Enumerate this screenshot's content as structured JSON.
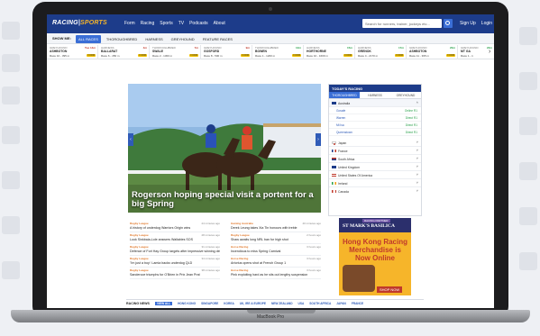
{
  "device": {
    "label": "MacBook Pro"
  },
  "site": {
    "logo_part1": "RACING",
    "logo_part2": "SPORTS",
    "menu": [
      "Form",
      "Racing",
      "Sports",
      "TV",
      "Podcasts",
      "About"
    ],
    "search_placeholder": "Search for runners, trainer, jockeys etc...",
    "signup": "Sign Up",
    "login": "Login"
  },
  "filters": {
    "label": "SHOW ME:",
    "items": [
      "ALL RACES",
      "THOROUGHBRED",
      "HARNESS",
      "GREYHOUND",
      "FEATURE RACES"
    ]
  },
  "races": [
    {
      "type": "GREYHOUND",
      "time": "Tue 14m",
      "venue": "ASHBOTON",
      "detail": "Race 10 - 395 m",
      "badge": "FORM"
    },
    {
      "type": "HARNESS",
      "time": "4m",
      "venue": "BALLARAT",
      "detail": "Race 6 - 450 m",
      "badge": "FORM"
    },
    {
      "type": "THOROUGHBRED",
      "time": "7m",
      "venue": "SWALE",
      "detail": "Race 2 - 1300 m",
      "badge": "FORM"
    },
    {
      "type": "GREYHOUND",
      "time": "9m",
      "venue": "GOSFORD",
      "detail": "Race 8 - 500 m",
      "badge": "FORM"
    },
    {
      "type": "THOROUGHBRED",
      "time": "12m",
      "venue": "BOWEN",
      "detail": "Race 1 - 1200 m",
      "badge": "FORM"
    },
    {
      "type": "HARNESS",
      "time": "15m",
      "venue": "HORTHORNE",
      "detail": "Race 10 - 1609 m",
      "badge": "FORM"
    },
    {
      "type": "HARNESS",
      "time": "17m",
      "venue": "GRENOK",
      "detail": "Race 4 - 2170 m",
      "badge": "FORM"
    },
    {
      "type": "GREYHOUND",
      "time": "20m",
      "venue": "ASHBOTON",
      "detail": "Race 11 - 395 m",
      "badge": "FORM"
    },
    {
      "type": "GREYHOUND",
      "time": "22m",
      "venue": "MT GA",
      "detail": "Race 1 - 1",
      "badge": ""
    }
  ],
  "hero": {
    "title": "Rogerson hoping special visit a portent for a big Spring"
  },
  "todays_racing": {
    "header": "TODAY'S RACING",
    "tabs": [
      "THOROUGHBRED",
      "HARNESS",
      "GREYHOUND"
    ],
    "australia": "Australia",
    "states": [
      {
        "name": "Gosafe",
        "value": "Online R1"
      },
      {
        "name": "Warren",
        "value": "Direct R1"
      },
      {
        "name": "Mt Isa",
        "value": "Direct R1"
      },
      {
        "name": "Queenstown",
        "value": "Direct R1"
      }
    ],
    "countries": [
      "Japan",
      "France",
      "South Africa",
      "United Kingdom",
      "United States Of America",
      "Ireland",
      "Canada"
    ]
  },
  "ad": {
    "tag": "RACING PARTNER",
    "brand": "ST MARK'S BASILICA",
    "text": "Hong Kong Racing Merchandise is Now Online",
    "cta": "SHOP NOW"
  },
  "news_left": [
    {
      "cat": "Rugby League",
      "time": "24 minutes ago",
      "head": "A history of underdog Warriors Origin wins"
    },
    {
      "cat": "Rugby League",
      "time": "28 minutes ago",
      "head": "Look Sinkbaia-Lole answers Wallabies SOS"
    },
    {
      "cat": "Rugby League",
      "time": "31 minutes ago",
      "head": "Defence of Fort Hay Group targets after impressive winning debut"
    },
    {
      "cat": "Rugby League",
      "time": "34 minutes ago",
      "head": "'I'm just a boy': Lamia backs underdog QLD"
    },
    {
      "cat": "Rugby League",
      "time": "38 minutes ago",
      "head": "Sandercoe triumphs for O'Brien in Prix Jean Prat"
    }
  ],
  "news_right": [
    {
      "cat": "Gaming Australia",
      "time": "40 minutes ago",
      "head": "Derek Leung takes Xia Tin honours with treble"
    },
    {
      "cat": "Rugby League",
      "time": "2 hours ago",
      "head": "Shaw awaits long NRL ban for high shot"
    },
    {
      "cat": "Horse Racing",
      "time": "3 hours ago",
      "head": "Incendious to miss Spring Carnival"
    },
    {
      "cat": "Horse Racing",
      "time": "3 hours ago",
      "head": "Artorius opens shot at French Group 1"
    },
    {
      "cat": "Horse Racing",
      "time": "3 hours ago",
      "head": "Pink exploiting hard as he sits out lengthy suspension"
    }
  ],
  "footer_strip": {
    "label": "RACING NEWS",
    "items": [
      "VIEW ALL",
      "HONG KONG",
      "SINGAPORE",
      "KOREA",
      "UK, IRE & EUROPE",
      "NEW ZEALAND",
      "USA",
      "SOUTH AFRICA",
      "JAPAN",
      "FRANCE"
    ]
  },
  "colors": {
    "brand": "#1d3c8a",
    "accent": "#3a6ed6",
    "gold": "#f6b52a"
  }
}
